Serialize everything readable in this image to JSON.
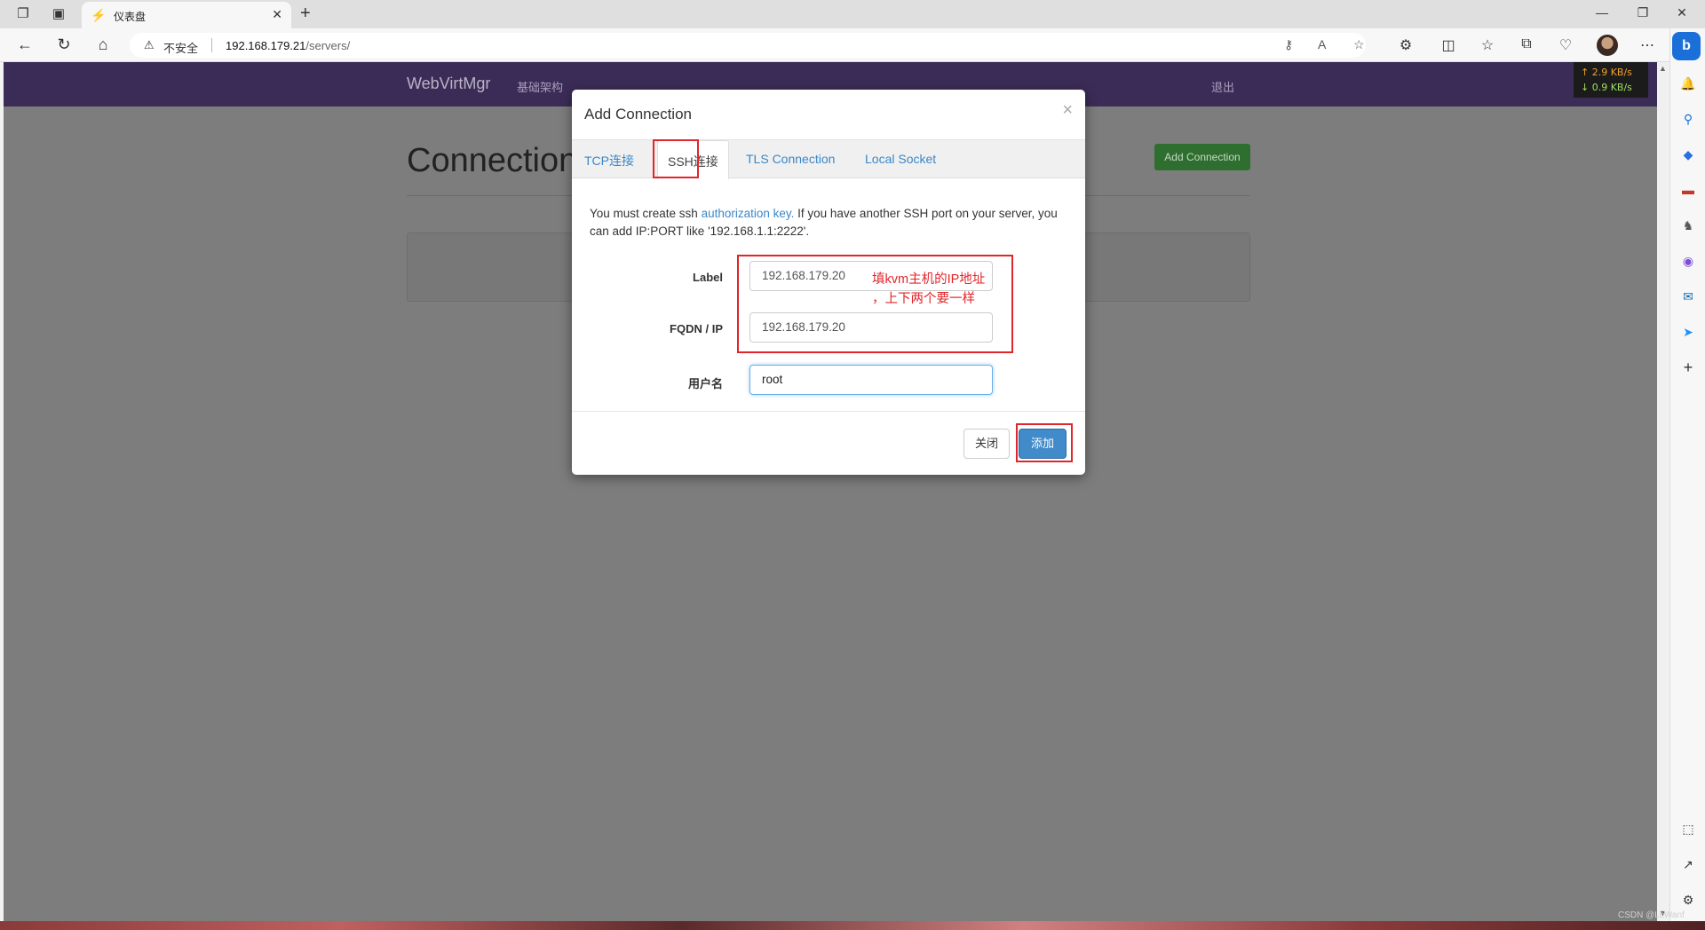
{
  "browser": {
    "tab_title": "仪表盘",
    "insecure_label": "不安全",
    "url_host": "192.168.179.21",
    "url_path": "/servers/"
  },
  "net_speed": {
    "up": "↑ 2.9 KB/s",
    "down": "↓ 0.9 KB/s"
  },
  "navbar": {
    "brand": "WebVirtMgr",
    "infrastructure": "基础架构",
    "logout": "退出"
  },
  "page": {
    "heading": "Connections",
    "add_connection_button": "Add Connection"
  },
  "modal": {
    "title": "Add Connection",
    "close_x": "×",
    "tabs": [
      {
        "label": "TCP连接",
        "active": false
      },
      {
        "label": "SSH连接",
        "active": true
      },
      {
        "label": "TLS Connection",
        "active": false
      },
      {
        "label": "Local Socket",
        "active": false
      }
    ],
    "info_prefix": "You must create ssh ",
    "info_link": "authorization key.",
    "info_suffix": " If you have another SSH port on your server, you can add IP:PORT like '192.168.1.1:2222'.",
    "fields": {
      "label": {
        "label": "Label",
        "value": "192.168.179.20"
      },
      "fqdn": {
        "label": "FQDN / IP",
        "value": "192.168.179.20"
      },
      "username": {
        "label": "用户名",
        "value": "root"
      }
    },
    "close_button": "关闭",
    "add_button": "添加"
  },
  "annotation": {
    "line1": "填kvm主机的IP地址",
    "line2": "，上下两个要一样"
  },
  "watermark": "CSDN @LcWanf",
  "colors": {
    "navbar": "#3b2c57",
    "overlay": "#7d7d7d",
    "primary": "#428bca",
    "annotation_red": "#e0262b"
  }
}
